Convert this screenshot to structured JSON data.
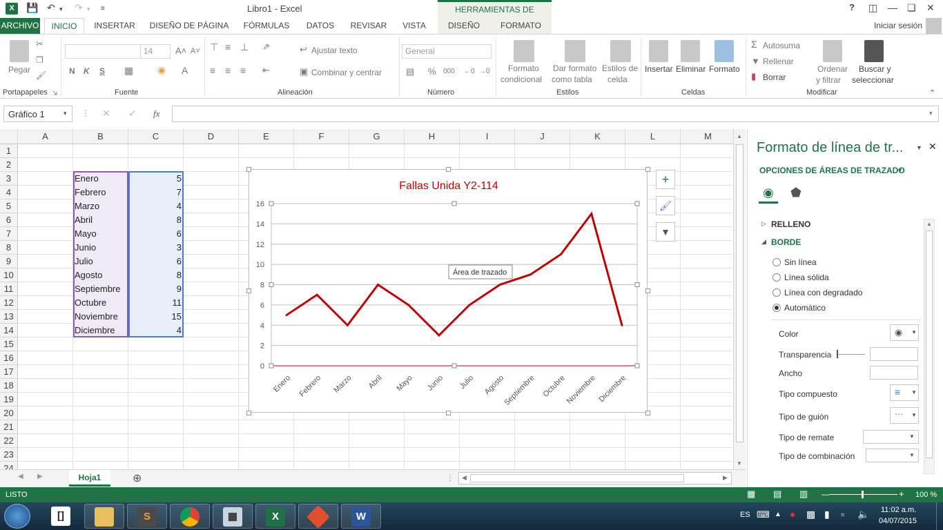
{
  "titlebar": {
    "app_icon": "X",
    "window_title": "Libro1 - Excel",
    "contextual_group": "HERRAMIENTAS DE GRÁFICOS",
    "help": "?"
  },
  "tabs": {
    "file": "ARCHIVO",
    "home": "INICIO",
    "insert": "INSERTAR",
    "page_layout": "DISEÑO DE PÁGINA",
    "formulas": "FÓRMULAS",
    "data": "DATOS",
    "review": "REVISAR",
    "view": "VISTA",
    "design": "DISEÑO",
    "format": "FORMATO",
    "signin": "Iniciar sesión"
  },
  "ribbon": {
    "clipboard": {
      "paste": "Pegar",
      "label": "Portapapeles"
    },
    "font": {
      "size": "14",
      "bold": "N",
      "italic": "K",
      "underline": "S",
      "label": "Fuente"
    },
    "alignment": {
      "wrap": "Ajustar texto",
      "merge": "Combinar y centrar",
      "label": "Alineación"
    },
    "number": {
      "format": "General",
      "label": "Número"
    },
    "styles": {
      "conditional": [
        "Formato",
        "condicional"
      ],
      "as_table": [
        "Dar formato",
        "como tabla"
      ],
      "cell_styles": [
        "Estilos de",
        "celda"
      ],
      "label": "Estilos"
    },
    "cells": {
      "insert": "Insertar",
      "delete": "Eliminar",
      "format": "Formato",
      "label": "Celdas"
    },
    "editing": {
      "autosum": "Autosuma",
      "fill": "Rellenar",
      "clear": "Borrar",
      "sort": [
        "Ordenar",
        "y filtrar"
      ],
      "find": [
        "Buscar y",
        "seleccionar"
      ],
      "label": "Modificar"
    }
  },
  "formula_bar": {
    "name_box": "Gráfico 1",
    "fx": "fx",
    "value": ""
  },
  "sheet": {
    "columns": [
      "A",
      "B",
      "C",
      "D",
      "E",
      "F",
      "G",
      "H",
      "I",
      "J",
      "K",
      "L",
      "M"
    ],
    "rows": [
      "1",
      "2",
      "3",
      "4",
      "5",
      "6",
      "7",
      "8",
      "9",
      "10",
      "11",
      "12",
      "13",
      "14",
      "15",
      "16",
      "17",
      "18",
      "19",
      "20",
      "21",
      "22",
      "23",
      "24"
    ],
    "months": [
      "Enero",
      "Febrero",
      "Marzo",
      "Abril",
      "Mayo",
      "Junio",
      "Julio",
      "Agosto",
      "Septiembre",
      "Octubre",
      "Noviembre",
      "Diciembre"
    ],
    "values": [
      "5",
      "7",
      "4",
      "8",
      "6",
      "3",
      "6",
      "8",
      "9",
      "11",
      "15",
      "4"
    ]
  },
  "chart_data": {
    "type": "line",
    "title": "Fallas Unida Y2-114",
    "categories": [
      "Enero",
      "Febrero",
      "Marzo",
      "Abril",
      "Mayo",
      "Junio",
      "Julio",
      "Agosto",
      "Septiembre",
      "Octubre",
      "Noviembre",
      "Diciembre"
    ],
    "series": [
      {
        "values": [
          5,
          7,
          4,
          8,
          6,
          3,
          6,
          8,
          9,
          11,
          15,
          4
        ],
        "color": "#c00000"
      }
    ],
    "y_ticks": [
      "0",
      "2",
      "4",
      "6",
      "8",
      "10",
      "12",
      "14",
      "16"
    ],
    "ylim": [
      0,
      16
    ],
    "grid": true,
    "tooltip": "Área de trazado",
    "title_color": "#c00000"
  },
  "format_pane": {
    "title": "Formato de línea de tr...",
    "options_header": "OPCIONES DE ÁREAS DE TRAZADO",
    "fill_section": "RELLENO",
    "border_section": "BORDE",
    "radio_options": [
      "Sin línea",
      "Línea sólida",
      "Línea con degradado",
      "Automático"
    ],
    "selected_option": "Automático",
    "fields": [
      "Color",
      "Transparencia",
      "Ancho",
      "Tipo compuesto",
      "Tipo de guión",
      "Tipo de remate",
      "Tipo de combinación"
    ]
  },
  "sheet_tabs": {
    "active": "Hoja1",
    "add": "⊕"
  },
  "status": {
    "ready": "LISTO",
    "zoom": "100 %"
  },
  "taskbar": {
    "lang": "ES",
    "time": "11:02 a.m.",
    "date": "04/07/2015",
    "apps": [
      "terminal-icon",
      "file-explorer-icon",
      "sublime-icon",
      "chrome-icon",
      "calculator-icon",
      "excel-icon",
      "git-icon",
      "word-icon"
    ]
  },
  "colors": {
    "excel_green": "#217346",
    "series_red": "#c00000",
    "pane_title": "#217346"
  }
}
